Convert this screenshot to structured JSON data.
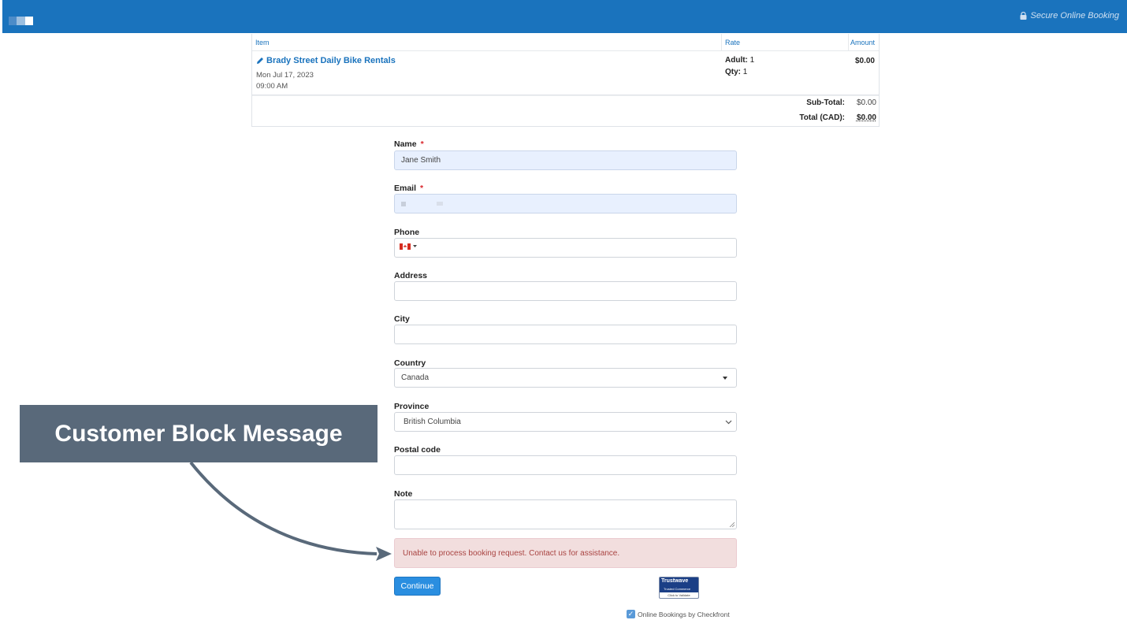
{
  "header": {
    "secure_label": "Secure Online Booking"
  },
  "cart": {
    "columns": {
      "item": "Item",
      "rate": "Rate",
      "amount": "Amount"
    },
    "item_title": "Brady Street Daily Bike Rentals",
    "item_date": "Mon Jul 17, 2023",
    "item_time": "09:00 AM",
    "rate_adult_label": "Adult:",
    "rate_adult_value": "1",
    "rate_qty_label": "Qty:",
    "rate_qty_value": "1",
    "amount": "$0.00",
    "subtotal_label": "Sub-Total:",
    "subtotal_value": "$0.00",
    "total_label": "Total (CAD):",
    "total_value": "$0.00"
  },
  "form": {
    "name_label": "Name",
    "name_value": "Jane Smith",
    "email_label": "Email",
    "phone_label": "Phone",
    "address_label": "Address",
    "city_label": "City",
    "country_label": "Country",
    "country_value": "Canada",
    "province_label": "Province",
    "province_value": "British Columbia",
    "postal_label": "Postal code",
    "note_label": "Note",
    "required_mark": "*"
  },
  "alert": {
    "message": "Unable to process booking request. Contact us for assistance."
  },
  "continue_label": "Continue",
  "trustwave": {
    "brand": "Trustwave",
    "line2": "Trusted Commerce",
    "line3": "Click to Validate"
  },
  "footer": {
    "powered_by": "Online Bookings by Checkfront"
  },
  "annotation": {
    "callout": "Customer Block Message"
  },
  "colors": {
    "header": "#1a73bd",
    "alert_bg": "#f2dede",
    "alert_text": "#a94442",
    "button": "#2a8ee0",
    "callout_bg": "#59697a"
  }
}
